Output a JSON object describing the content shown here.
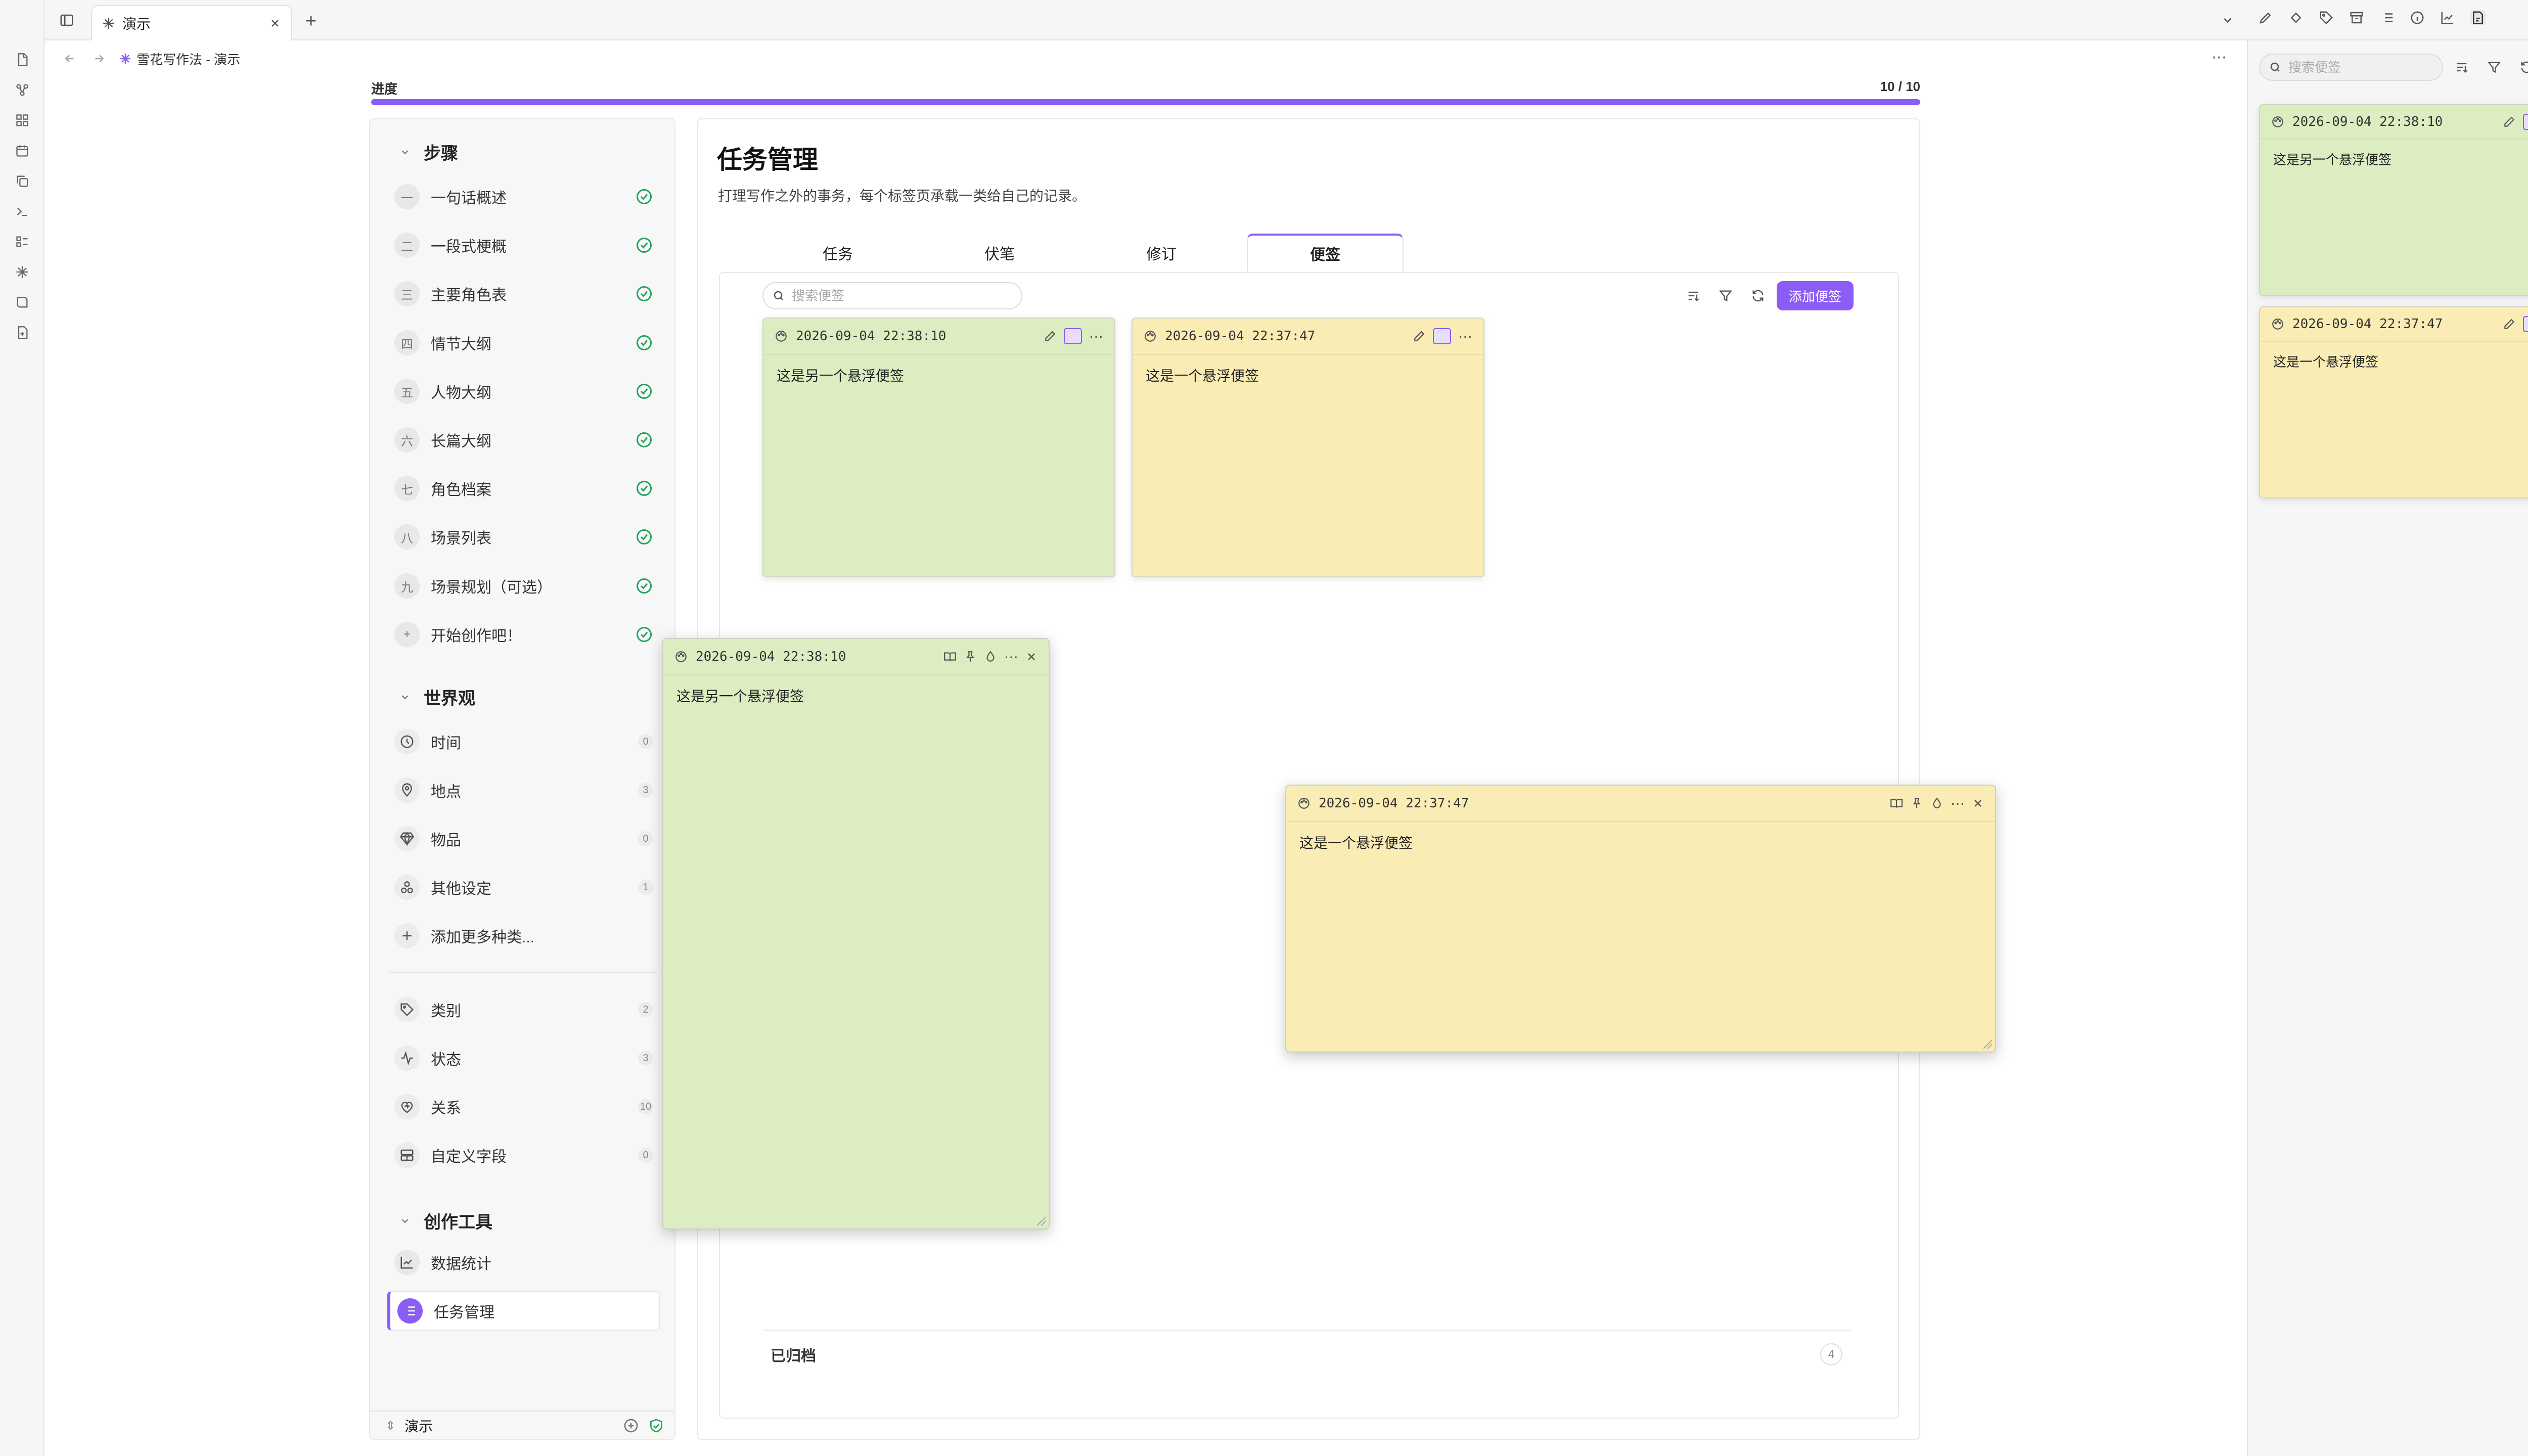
{
  "tab": {
    "title": "演示"
  },
  "breadcrumb": {
    "text": "雪花写作法 - 演示"
  },
  "progress": {
    "label": "进度",
    "value_text": "10 / 10",
    "fraction": 1.0
  },
  "nav": {
    "steps_title": "步骤",
    "steps": [
      {
        "num": "一",
        "label": "一句话概述"
      },
      {
        "num": "二",
        "label": "一段式梗概"
      },
      {
        "num": "三",
        "label": "主要角色表"
      },
      {
        "num": "四",
        "label": "情节大纲"
      },
      {
        "num": "五",
        "label": "人物大纲"
      },
      {
        "num": "六",
        "label": "长篇大纲"
      },
      {
        "num": "七",
        "label": "角色档案"
      },
      {
        "num": "八",
        "label": "场景列表"
      },
      {
        "num": "九",
        "label": "场景规划（可选）"
      },
      {
        "num": "+",
        "label": "开始创作吧！"
      }
    ],
    "world_title": "世界观",
    "world": [
      {
        "icon": "clock-icon",
        "label": "时间",
        "count": "0"
      },
      {
        "icon": "map-pin-icon",
        "label": "地点",
        "count": "3"
      },
      {
        "icon": "gem-icon",
        "label": "物品",
        "count": "0"
      },
      {
        "icon": "shapes-icon",
        "label": "其他设定",
        "count": "1"
      },
      {
        "icon": "plus-icon",
        "label": "添加更多种类...",
        "count": ""
      }
    ],
    "meta": [
      {
        "icon": "tag-icon",
        "label": "类别",
        "count": "2"
      },
      {
        "icon": "activity-icon",
        "label": "状态",
        "count": "3"
      },
      {
        "icon": "heart-icon",
        "label": "关系",
        "count": "10"
      },
      {
        "icon": "fields-icon",
        "label": "自定义字段",
        "count": "0"
      }
    ],
    "tools_title": "创作工具",
    "tools": [
      {
        "icon": "chart-icon",
        "label": "数据统计"
      },
      {
        "icon": "list-icon",
        "label": "任务管理"
      }
    ],
    "footer_label": "演示"
  },
  "main": {
    "title": "任务管理",
    "subtitle": "打理写作之外的事务，每个标签页承载一类给自己的记录。",
    "tabs": [
      "任务",
      "伏笔",
      "修订",
      "便签"
    ],
    "search_placeholder": "搜索便签",
    "add_label": "添加便签",
    "notes": [
      {
        "timestamp": "2026-09-04 22:38:10",
        "content": "这是另一个悬浮便签",
        "color": "#dcedc2"
      },
      {
        "timestamp": "2026-09-04 22:37:47",
        "content": "这是一个悬浮便签",
        "color": "#f9ecb5"
      }
    ],
    "archived_label": "已归档",
    "archived_count": "4"
  },
  "floating": [
    {
      "timestamp": "2026-09-04 22:38:10",
      "content": "这是另一个悬浮便签"
    },
    {
      "timestamp": "2026-09-04 22:37:47",
      "content": "这是一个悬浮便签"
    }
  ],
  "right": {
    "search_placeholder": "搜索便签",
    "notes": [
      {
        "timestamp": "2026-09-04 22:38:10",
        "content": "这是另一个悬浮便签"
      },
      {
        "timestamp": "2026-09-04 22:37:47",
        "content": "这是一个悬浮便签"
      }
    ]
  },
  "colors": {
    "accent": "#8b5cf6",
    "check": "#22a35a",
    "note_green": "#dcedc2",
    "note_yellow": "#f9ecb5"
  }
}
